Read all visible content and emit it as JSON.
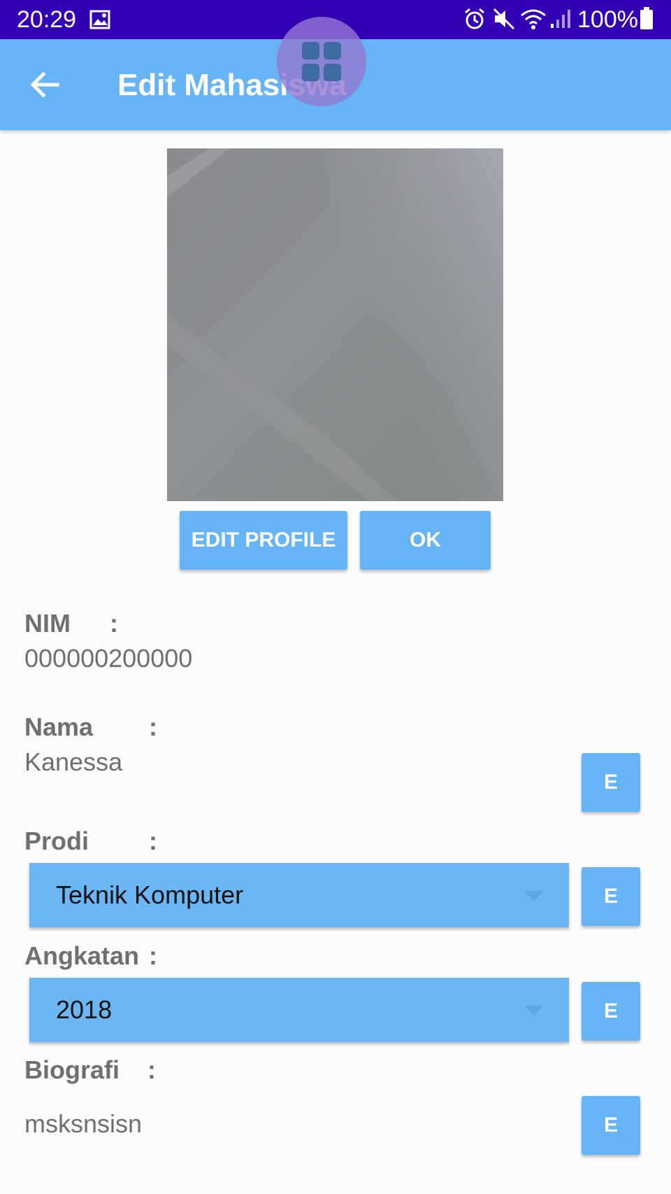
{
  "status_bar": {
    "time": "20:29",
    "battery": "100%",
    "icons": [
      "image-icon",
      "alarm-icon",
      "mute-icon",
      "wifi-icon",
      "signal-icon",
      "battery-icon"
    ]
  },
  "app_bar": {
    "title": "Edit Mahasiswa",
    "back_icon": "arrow-left-icon",
    "overlay_icon": "grid-icon"
  },
  "buttons": {
    "edit_profile": "EDIT PROFILE",
    "ok": "OK",
    "edit_short": "E"
  },
  "fields": {
    "nim": {
      "label": "NIM",
      "colon": ":",
      "value": "000000200000"
    },
    "nama": {
      "label": "Nama",
      "colon": ":",
      "value": "Kanessa"
    },
    "prodi": {
      "label": "Prodi",
      "colon": ":",
      "selected": "Teknik Komputer"
    },
    "angkatan": {
      "label": "Angkatan",
      "colon": ":",
      "selected": "2018"
    },
    "biografi": {
      "label": "Biografi",
      "colon": ":",
      "value": "msksnsisn"
    }
  },
  "colors": {
    "status_bar": "#3300b3",
    "app_bar": "#66b3f5",
    "button": "#66b3f5",
    "text_gray": "#6f6f6f"
  }
}
